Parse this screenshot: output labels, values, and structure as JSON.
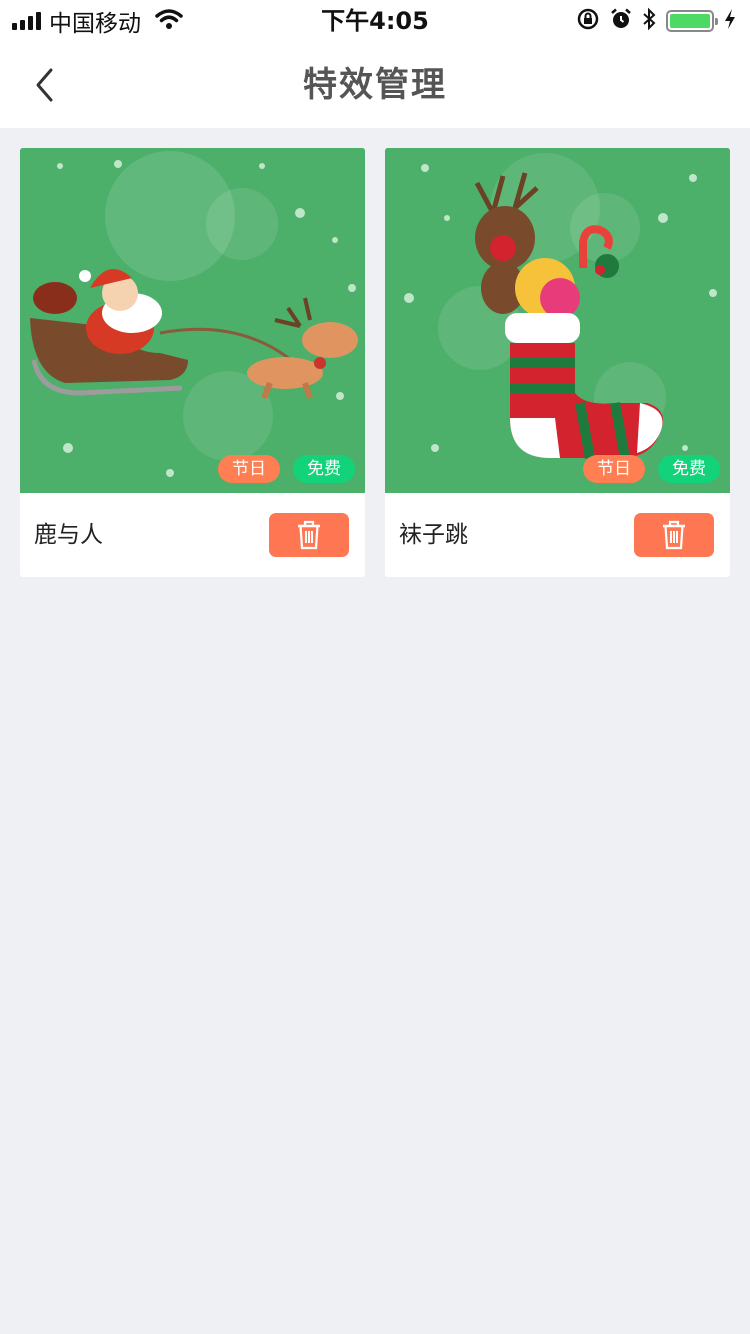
{
  "status_bar": {
    "carrier": "中国移动",
    "time": "下午4:05",
    "icons": [
      "signal-icon",
      "wifi-icon",
      "rotation-lock-icon",
      "alarm-icon",
      "bluetooth-icon",
      "battery-icon",
      "charging-icon"
    ],
    "battery_color": "#4cd964"
  },
  "nav": {
    "title": "特效管理",
    "back_icon": "chevron-left-icon"
  },
  "effects": [
    {
      "name": "鹿与人",
      "image": "santa-sleigh-reindeer-illustration",
      "tags": [
        "节日",
        "免费"
      ],
      "delete_icon": "trash-icon"
    },
    {
      "name": "袜子跳",
      "image": "christmas-stocking-reindeer-illustration",
      "tags": [
        "节日",
        "免费"
      ],
      "delete_icon": "trash-icon"
    }
  ],
  "colors": {
    "background": "#eff0f4",
    "thumb_green": "#4caf6a",
    "tag_festival": "#ff7f52",
    "tag_free": "#12d37a",
    "delete_button": "#ff7752"
  }
}
